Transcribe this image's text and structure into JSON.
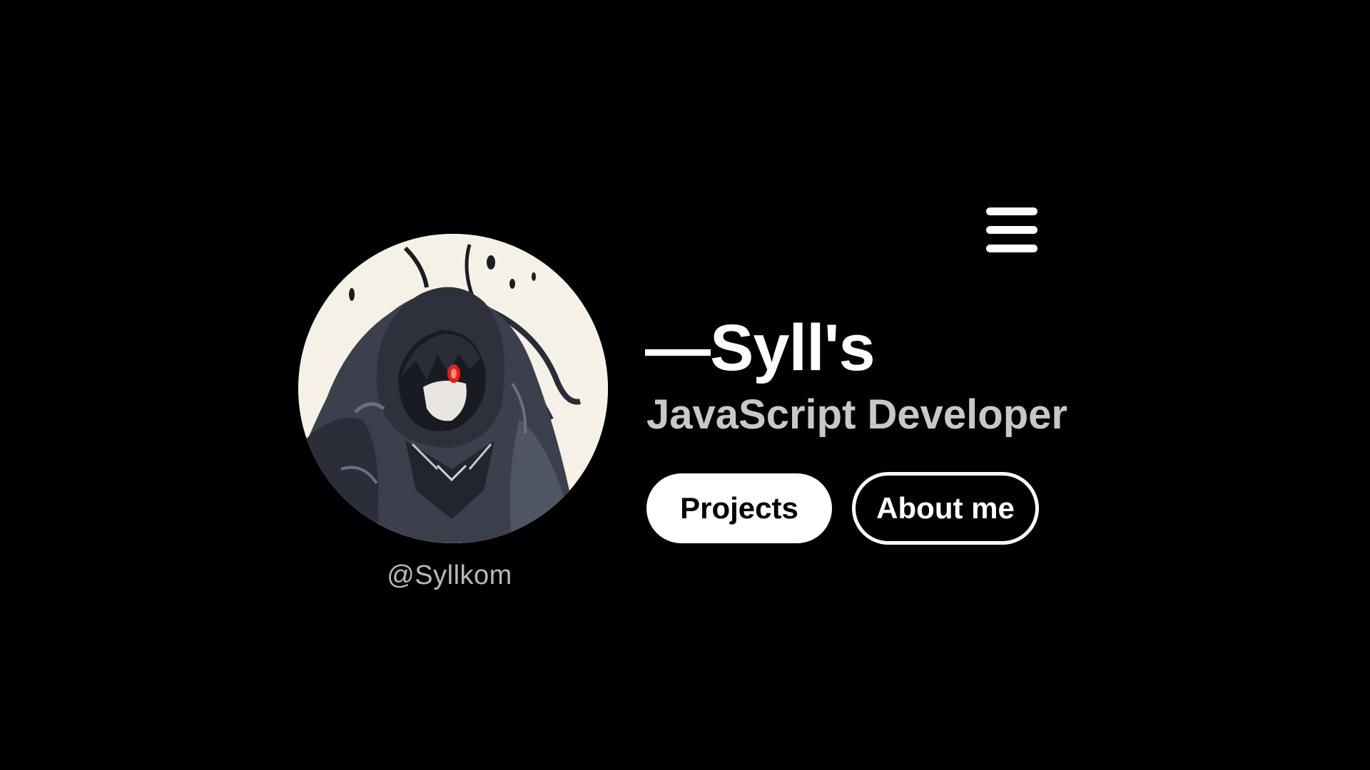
{
  "profile": {
    "name": "—Syll's",
    "role": "JavaScript Developer",
    "handle": "@Syllkom"
  },
  "nav": {
    "menu_icon": "hamburger-menu-icon"
  },
  "actions": {
    "projects_label": "Projects",
    "about_label": "About me"
  },
  "colors": {
    "background": "#000000",
    "primary_text": "#ffffff",
    "secondary_text": "#c8c8c8",
    "handle_text": "#b9b9b9",
    "avatar_backdrop": "#f6f1e6",
    "accent_eye": "#e0201a"
  }
}
